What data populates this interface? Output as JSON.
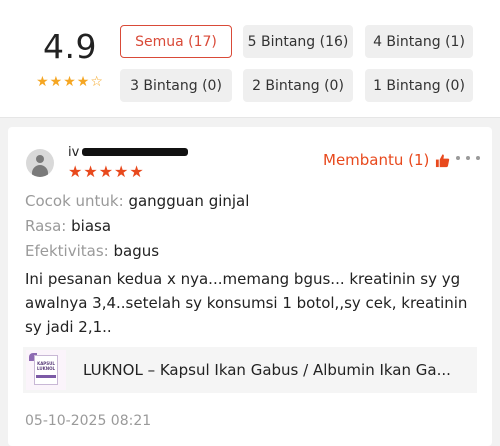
{
  "rating": {
    "average": "4.9",
    "stars_filled": 4,
    "stars_total": 5
  },
  "filters": [
    {
      "label": "Semua (17)",
      "active": true
    },
    {
      "label": "5 Bintang (16)",
      "active": false
    },
    {
      "label": "4 Bintang (1)",
      "active": false
    },
    {
      "label": "3 Bintang (0)",
      "active": false
    },
    {
      "label": "2 Bintang (0)",
      "active": false
    },
    {
      "label": "1 Bintang (0)",
      "active": false
    }
  ],
  "review": {
    "reviewer_name": "iv",
    "stars": 5,
    "helpful_label": "Membantu (1)",
    "attributes": [
      {
        "key": "Cocok untuk:",
        "value": "gangguan ginjal"
      },
      {
        "key": "Rasa:",
        "value": "biasa"
      },
      {
        "key": "Efektivitas:",
        "value": "bagus"
      }
    ],
    "text": "Ini pesanan kedua x nya...memang bgus... kreatinin sy yg awalnya 3,4..setelah sy konsumsi 1 botol,,sy cek, kreatinin sy jadi 2,1..",
    "product": {
      "title": "LUKNOL – Kapsul Ikan Gabus / Albumin Ikan Ga...",
      "thumb_label": "KAPSUL LUKNOL"
    },
    "date": "05-10-2025 08:21"
  },
  "colors": {
    "accent": "#e8491d",
    "star_summary": "#f5a623",
    "muted": "#9a9a9a"
  },
  "icons": {
    "avatar": "user-avatar-icon",
    "helpful": "thumbs-up-icon",
    "more": "more-options-icon",
    "star": "star-icon"
  }
}
